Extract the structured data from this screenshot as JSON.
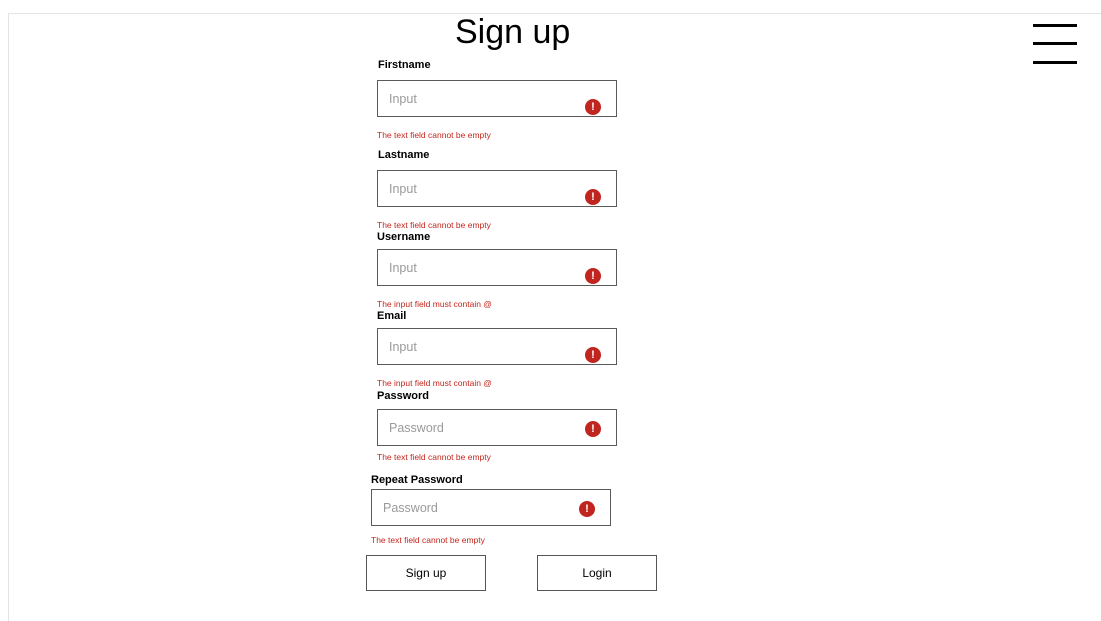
{
  "header": {
    "title": "Sign up"
  },
  "form": {
    "fields": [
      {
        "label": "Firstname",
        "placeholder": "Input",
        "value": "",
        "error": "The text field cannot be empty"
      },
      {
        "label": "Lastname",
        "placeholder": "Input",
        "value": "",
        "error": "The text field cannot be empty"
      },
      {
        "label": "Username",
        "placeholder": "Input",
        "value": "",
        "error": "The input field must contain @"
      },
      {
        "label": "Email",
        "placeholder": "Input",
        "value": "",
        "error": "The input field must contain @"
      },
      {
        "label": "Password",
        "placeholder": "Password",
        "value": "",
        "error": "The text field cannot be empty"
      },
      {
        "label": "Repeat Password",
        "placeholder": "Password",
        "value": "",
        "error": "The text field cannot be empty"
      }
    ],
    "error_icon_glyph": "!",
    "error_icon": "exclamation-circle-icon",
    "menu_icon": "hamburger-menu-icon",
    "error_color": "#c4261c"
  },
  "actions": {
    "signup_label": "Sign up",
    "login_label": "Login"
  }
}
